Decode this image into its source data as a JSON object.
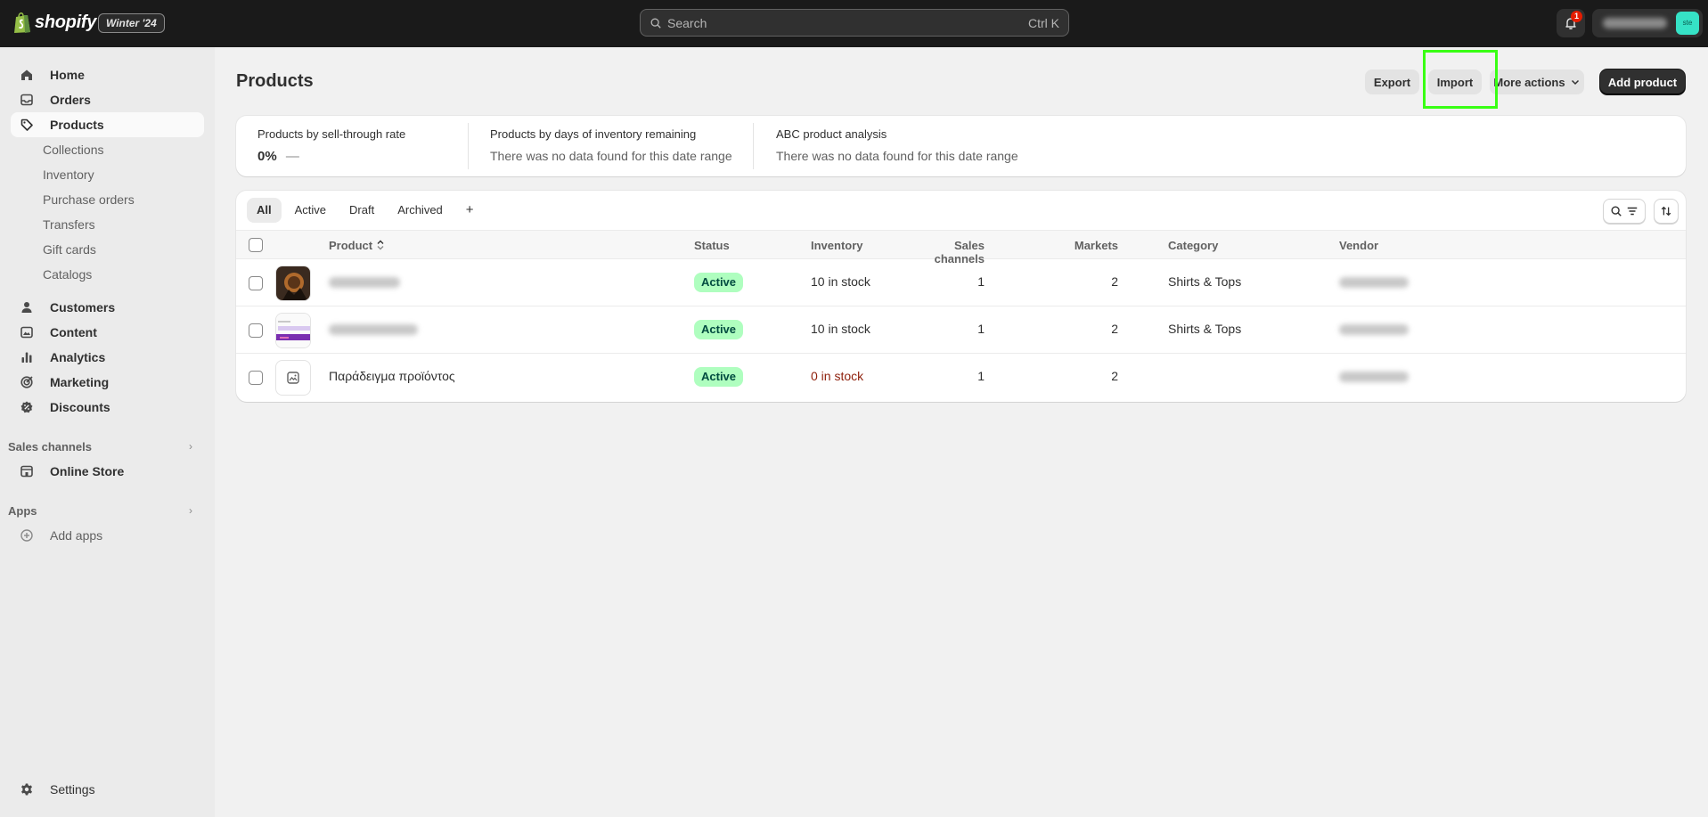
{
  "topbar": {
    "logo_text": "shopify",
    "edition": "Winter '24",
    "search": {
      "placeholder": "Search",
      "shortcut": "Ctrl K"
    },
    "notification_count": "1",
    "store_avatar_text": "ste"
  },
  "sidebar": {
    "items": [
      {
        "label": "Home",
        "icon": "home-icon"
      },
      {
        "label": "Orders",
        "icon": "inbox-icon"
      },
      {
        "label": "Products",
        "icon": "tag-icon",
        "active": true
      }
    ],
    "product_subitems": [
      "Collections",
      "Inventory",
      "Purchase orders",
      "Transfers",
      "Gift cards",
      "Catalogs"
    ],
    "items2": [
      {
        "label": "Customers",
        "icon": "person-icon"
      },
      {
        "label": "Content",
        "icon": "content-icon"
      },
      {
        "label": "Analytics",
        "icon": "bar-chart-icon"
      },
      {
        "label": "Marketing",
        "icon": "target-icon"
      },
      {
        "label": "Discounts",
        "icon": "discount-icon"
      }
    ],
    "sales_channels_title": "Sales channels",
    "online_store": "Online Store",
    "apps_title": "Apps",
    "add_apps": "Add apps",
    "settings": "Settings"
  },
  "page": {
    "title": "Products",
    "actions": {
      "export": "Export",
      "import": "Import",
      "more_actions": "More actions",
      "add_product": "Add product"
    }
  },
  "analytics": [
    {
      "label": "Products by sell-through rate",
      "value": "0%",
      "trend": "—"
    },
    {
      "label": "Products by days of inventory remaining",
      "value": "There was no data found for this date range"
    },
    {
      "label": "ABC product analysis",
      "value": "There was no data found for this date range"
    }
  ],
  "table": {
    "tabs": [
      "All",
      "Active",
      "Draft",
      "Archived",
      "+"
    ],
    "columns": {
      "product": "Product",
      "status": "Status",
      "inventory": "Inventory",
      "sales_channels": "Sales channels",
      "markets": "Markets",
      "category": "Category",
      "vendor": "Vendor"
    },
    "rows": [
      {
        "status": "Active",
        "inventory": "10 in stock",
        "sales_channels": "1",
        "markets": "2",
        "category": "Shirts & Tops"
      },
      {
        "status": "Active",
        "inventory": "10 in stock",
        "sales_channels": "1",
        "markets": "2",
        "category": "Shirts & Tops"
      },
      {
        "name": "Παράδειγμα προϊόντος",
        "status": "Active",
        "inventory": "0 in stock",
        "sales_channels": "1",
        "markets": "2",
        "category": ""
      }
    ]
  },
  "colors": {
    "topbar": "#1a1a1a",
    "highlight": "#39ff14",
    "active_badge": "#affebf",
    "out_of_stock": "#8e1f0b"
  }
}
